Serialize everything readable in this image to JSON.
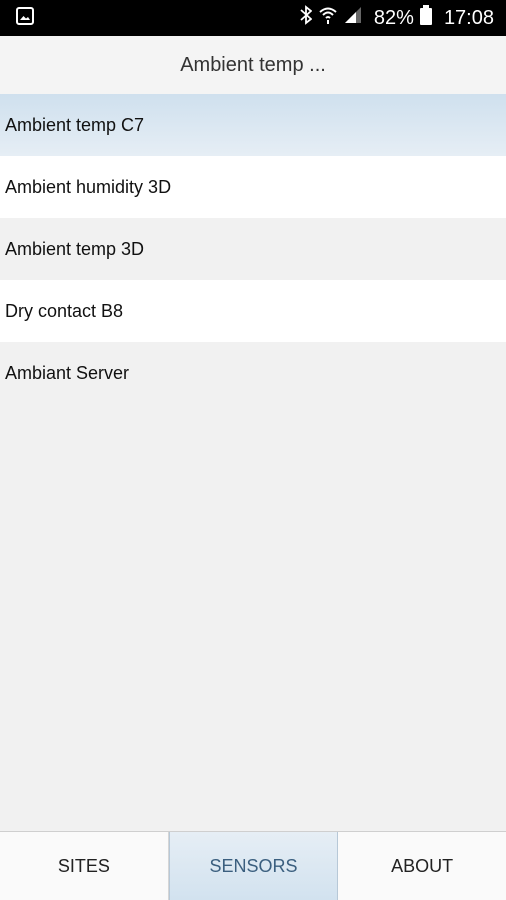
{
  "status_bar": {
    "battery_percent": "82%",
    "time": "17:08",
    "icons": [
      "gallery-icon",
      "bluetooth-icon",
      "wifi-icon",
      "signal-icon",
      "battery-icon"
    ]
  },
  "header": {
    "title": "Ambient temp ..."
  },
  "sensors": {
    "items": [
      {
        "label": "Ambient temp C7"
      },
      {
        "label": "Ambient humidity 3D"
      },
      {
        "label": "Ambient temp 3D"
      },
      {
        "label": "Dry contact B8"
      },
      {
        "label": "Ambiant Server"
      }
    ]
  },
  "tabs": [
    {
      "label": "SITES"
    },
    {
      "label": "SENSORS"
    },
    {
      "label": "ABOUT"
    }
  ],
  "colors": {
    "selected": "#d6e4ef",
    "tab_active_text": "#3b5f7f"
  }
}
